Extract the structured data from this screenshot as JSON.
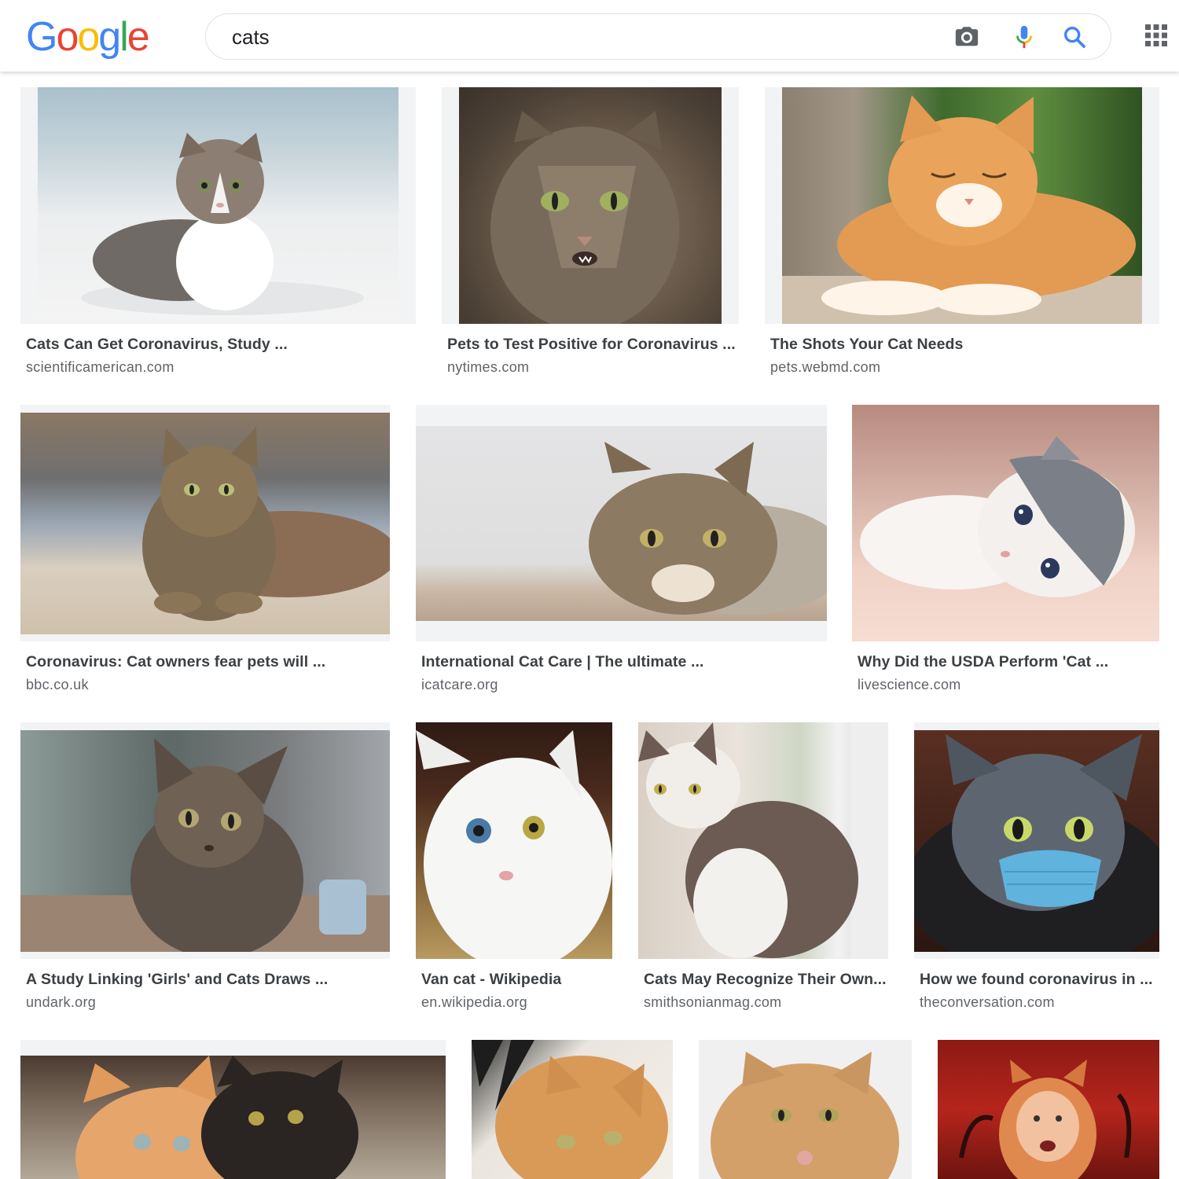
{
  "header": {
    "logo": [
      "G",
      "o",
      "o",
      "g",
      "l",
      "e"
    ],
    "logo_colors": [
      "#4285F4",
      "#EA4335",
      "#FBBC05",
      "#4285F4",
      "#34A853",
      "#EA4335"
    ],
    "search": {
      "query": "cats"
    },
    "icons": [
      "camera-icon",
      "microphone-icon",
      "search-icon",
      "apps-icon"
    ],
    "colors": {
      "blue": "#4285F4",
      "red": "#EA4335",
      "yellow": "#FBBC05",
      "green": "#34A853",
      "grey": "#5f6368"
    }
  },
  "results": [
    {
      "title": "Cats Can Get Coronavirus, Study ...",
      "source": "scientificamerican.com",
      "subject": "tabby and white kitten on white bedding"
    },
    {
      "title": "Pets to Test Positive for Coronavirus ...",
      "source": "nytimes.com",
      "subject": "long-haired tabby cat with green eyes"
    },
    {
      "title": "The Shots Your Cat Needs",
      "source": "pets.webmd.com",
      "subject": "orange and white cat with eyes closed"
    },
    {
      "title": "Coronavirus: Cat owners fear pets will ...",
      "source": "bbc.co.uk",
      "subject": "tabby cat lying on blanket"
    },
    {
      "title": "International Cat Care | The ultimate ...",
      "source": "icatcare.org",
      "subject": "tabby cat lying on the floor"
    },
    {
      "title": "Why Did the USDA Perform 'Cat ...",
      "source": "livescience.com",
      "subject": "grey and white kitten lying on pink blanket"
    },
    {
      "title": "A Study Linking 'Girls' and Cats Draws ...",
      "source": "undark.org",
      "subject": "tabby kitten"
    },
    {
      "title": "Van cat - Wikipedia",
      "source": "en.wikipedia.org",
      "subject": "white cat with odd eyes"
    },
    {
      "title": "Cats May Recognize Their Own...",
      "source": "smithsonianmag.com",
      "subject": "calico cat by a window"
    },
    {
      "title": "How we found coronavirus in ...",
      "source": "theconversation.com",
      "subject": "grey and white cat wearing a blue face mask"
    },
    {
      "title": "",
      "source": "",
      "subject": "orange and black kittens on a rug"
    },
    {
      "title": "",
      "source": "",
      "subject": "orange tabby cat on bed"
    },
    {
      "title": "",
      "source": "",
      "subject": "orange fluffy cat"
    },
    {
      "title": "",
      "source": "",
      "subject": "person in orange cat costume"
    }
  ]
}
